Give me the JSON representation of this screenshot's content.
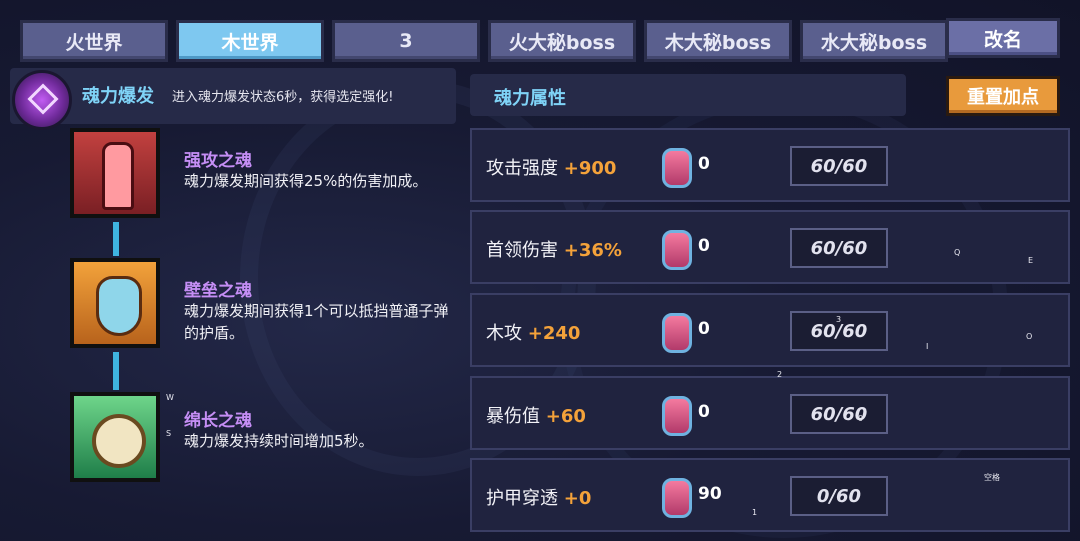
{
  "tabs": [
    "火世界",
    "木世界",
    "3",
    "火大秘boss",
    "木大秘boss",
    "水大秘boss"
  ],
  "active_tab": 1,
  "rename_label": "改名",
  "burst": {
    "title": "魂力爆发",
    "desc": "进入魂力爆发状态6秒，获得选定强化!"
  },
  "souls": [
    {
      "icon": "red-claw-soul-icon",
      "name": "强攻之魂",
      "desc": "魂力爆发期间获得25%的伤害加成。"
    },
    {
      "icon": "shield-soul-icon",
      "name": "壁垒之魂",
      "desc": "魂力爆发期间获得1个可以抵挡普通子弹的护盾。"
    },
    {
      "icon": "stopwatch-soul-icon",
      "name": "绵长之魂",
      "desc": "魂力爆发持续时间增加5秒。"
    }
  ],
  "attributes_title": "魂力属性",
  "reset_label": "重置加点",
  "attributes": [
    {
      "name": "攻击强度",
      "bonus": "+900",
      "gems": "0",
      "level": "60/60"
    },
    {
      "name": "首领伤害",
      "bonus": "+36%",
      "gems": "0",
      "level": "60/60"
    },
    {
      "name": "木攻",
      "bonus": "+240",
      "gems": "0",
      "level": "60/60"
    },
    {
      "name": "暴伤值",
      "bonus": "+60",
      "gems": "0",
      "level": "60/60"
    },
    {
      "name": "护甲穿透",
      "bonus": "+0",
      "gems": "90",
      "level": "0/60"
    }
  ],
  "overlay_keys": [
    "W",
    "S",
    "Q",
    "E",
    "3",
    "I",
    "O",
    "2",
    "0",
    "空格",
    "1"
  ]
}
